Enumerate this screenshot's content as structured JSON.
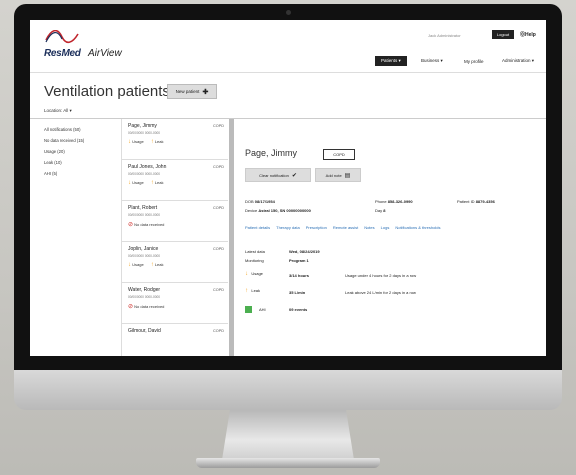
{
  "app": {
    "brand": "ResMed",
    "product": "AirView",
    "user_link": "Jack Administrator",
    "logout": "Logout",
    "help": "Help"
  },
  "nav": {
    "items": [
      {
        "label": "Patients ▾",
        "active": true
      },
      {
        "label": "Business ▾"
      },
      {
        "label": "My profile"
      },
      {
        "label": "Administration ▾"
      }
    ]
  },
  "page": {
    "title": "Ventilation patients",
    "new_patient": "New patient",
    "location_label": "Location:",
    "location_value": "All ▾"
  },
  "filters": [
    "All notifications (50)",
    "No data received (15)",
    "Usage (20)",
    "Leak (10)",
    "AHI (5)"
  ],
  "patients": [
    {
      "name": "Page, Jimmy",
      "tag": "COPD",
      "ids": "00/00/0000      0000-0000",
      "alerts": [
        "Usage",
        "Leak"
      ],
      "nodata": false
    },
    {
      "name": "Paul Jones, John",
      "tag": "COPD",
      "ids": "00/00/0000      0000-0000",
      "alerts": [
        "Usage",
        "Leak"
      ],
      "nodata": false
    },
    {
      "name": "Plant, Robert",
      "tag": "COPD",
      "ids": "00/00/0000      0000-0000",
      "nodata": true,
      "nodata_label": "No data received"
    },
    {
      "name": "Joplin, Janice",
      "tag": "COPD",
      "ids": "00/00/0000      0000-0000",
      "alerts": [
        "Usage",
        "Leak"
      ],
      "nodata": false
    },
    {
      "name": "Water, Rodger",
      "tag": "COPD",
      "ids": "00/00/0000      0000-0000",
      "nodata": true,
      "nodata_label": "No data received"
    },
    {
      "name": "Gilmour, David",
      "tag": "COPD",
      "ids": "",
      "alerts": [],
      "nodata": false
    }
  ],
  "detail": {
    "name": "Page, Jimmy",
    "tag": "COPD",
    "clear_notification": "Clear notification",
    "add_note": "Add note",
    "dob_label": "DOB",
    "dob": "08/17/1954",
    "phone_label": "Phone",
    "phone": "858-326-0990",
    "patient_id_label": "Patient ID",
    "patient_id": "8879-4356",
    "device_label": "Device",
    "device": "Astral 150, SN 00000000000",
    "day_label": "Day",
    "day": "8",
    "tabs": [
      "Patient details",
      "Therapy data",
      "Prescription",
      "Remote assist",
      "Notes",
      "Logs",
      "Notifications & thresholds"
    ],
    "latest_label": "Latest data",
    "latest": "Wed, 08/24/2019",
    "monitoring_label": "Monitoring",
    "monitoring": "Program 1",
    "rows": [
      {
        "label": "Usage",
        "value": "3/14 hours",
        "note": "Usage under 4 hours for 2 days in a row"
      },
      {
        "label": "Leak",
        "value": "35 L/min",
        "note": "Leak above 24 L/min for 2 days in a row"
      },
      {
        "label": "AHI",
        "value": "09 events",
        "note": ""
      }
    ]
  },
  "colors": {
    "accent": "#f5a623",
    "link": "#2a6fb5",
    "alert_red": "#d0312d",
    "ok_green": "#4caf50"
  }
}
